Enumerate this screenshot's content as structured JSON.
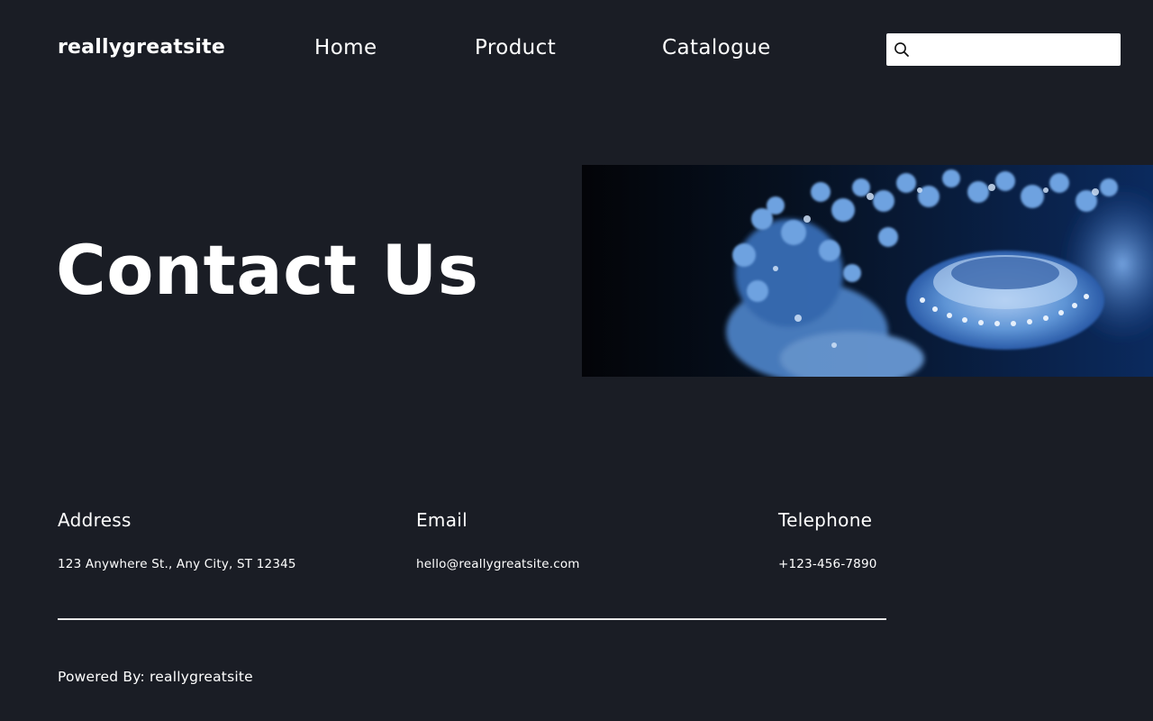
{
  "header": {
    "brand": "reallygreatsite",
    "nav": [
      {
        "label": "Home"
      },
      {
        "label": "Product"
      },
      {
        "label": "Catalogue"
      }
    ],
    "search": {
      "placeholder": "",
      "value": "",
      "icon": "search-icon"
    }
  },
  "hero": {
    "title": "Contact Us",
    "image": "jellyfish-photo"
  },
  "contact": {
    "address": {
      "heading": "Address",
      "value": "123 Anywhere St., Any City, ST 12345"
    },
    "email": {
      "heading": "Email",
      "value": "hello@reallygreatsite.com"
    },
    "telephone": {
      "heading": "Telephone",
      "value": "+123-456-7890"
    }
  },
  "footer": {
    "text": "Powered By: reallygreatsite"
  },
  "colors": {
    "background": "#1a1d25",
    "text": "#ffffff",
    "divider": "#e9e9e9",
    "accent": "#4a8fd8"
  }
}
